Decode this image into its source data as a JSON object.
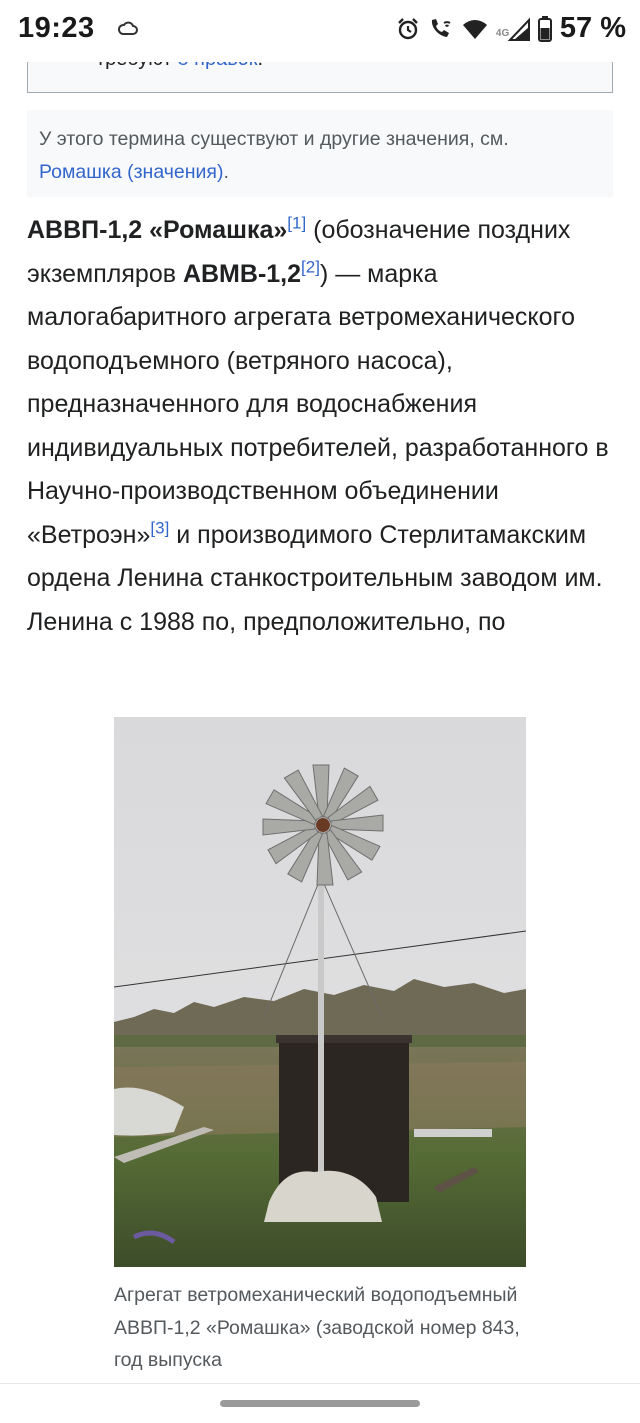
{
  "status_bar": {
    "time": "19:23",
    "network": "4G",
    "battery_percent": "57 %",
    "icons": [
      "cloud-icon",
      "alarm-icon",
      "wifi-call-icon",
      "wifi-icon",
      "signal-icon",
      "battery-icon"
    ]
  },
  "notice": {
    "text_before": "требуют ",
    "link": "8 правок",
    "text_after": "."
  },
  "hatnote": {
    "text": "У этого термина существуют и другие значения, см.",
    "link": "Ромашка (значения)",
    "text_after": "."
  },
  "article": {
    "name_bold": "АВВП-1,2 «Ромашка»",
    "ref1": "[1]",
    "p1": " (обозначение поздних экземпляров ",
    "name2_bold": "АВМВ-1,2",
    "ref2": "[2]",
    "p2": ") — марка малогабаритного агрегата ветромеханического водоподъемного (ветряного насоса), предназначенного для водоснабжения индивидуальных потребителей, разработанного в Научно-производственном объединении «Ветроэн»",
    "ref3": "[3]",
    "p3": " и производимого Стерлитамакским ордена Ленина станкостроительным заводом им. Ленина с 1988 по, предположительно, по"
  },
  "figure": {
    "caption": "Агрегат ветромеханический водоподъемный АВВП-1,2 «Ромашка» (заводской номер 843, год выпуска"
  },
  "colors": {
    "link": "#3366cc",
    "text": "#202122",
    "muted": "#54595d",
    "box_bg": "#f8f9fa"
  }
}
